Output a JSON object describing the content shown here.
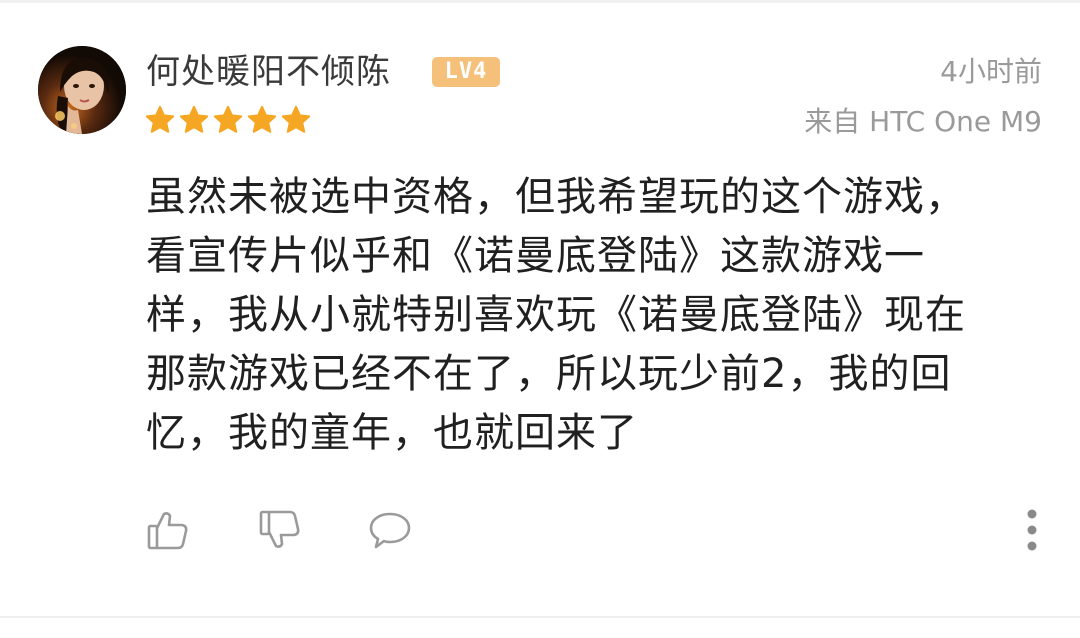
{
  "review": {
    "username": "何处暖阳不倾陈",
    "level": "LV4",
    "rating": 5,
    "rating_max": 5,
    "timestamp": "4小时前",
    "device": "来自 HTC One M9",
    "content_lines": [
      "虽然未被选中资格，但我希望玩的这个游戏，",
      "看宣传片似乎和《诺曼底登陆》这款游戏一",
      "样，我从小就特别喜欢玩《诺曼底登陆》现在",
      "那款游戏已经不在了，所以玩少前2，我的回",
      "忆，我的童年，也就回来了"
    ]
  },
  "colors": {
    "star": "#f5a623",
    "level_badge": "#f5c07a",
    "meta_text": "#9a9a9a",
    "username_text": "#3a3a3a",
    "body_text": "#202020",
    "icon_stroke": "#9a9a9a"
  },
  "icons": {
    "like": "thumbs-up-icon",
    "dislike": "thumbs-down-icon",
    "comment": "comment-bubble-icon",
    "more": "more-vertical-icon"
  }
}
